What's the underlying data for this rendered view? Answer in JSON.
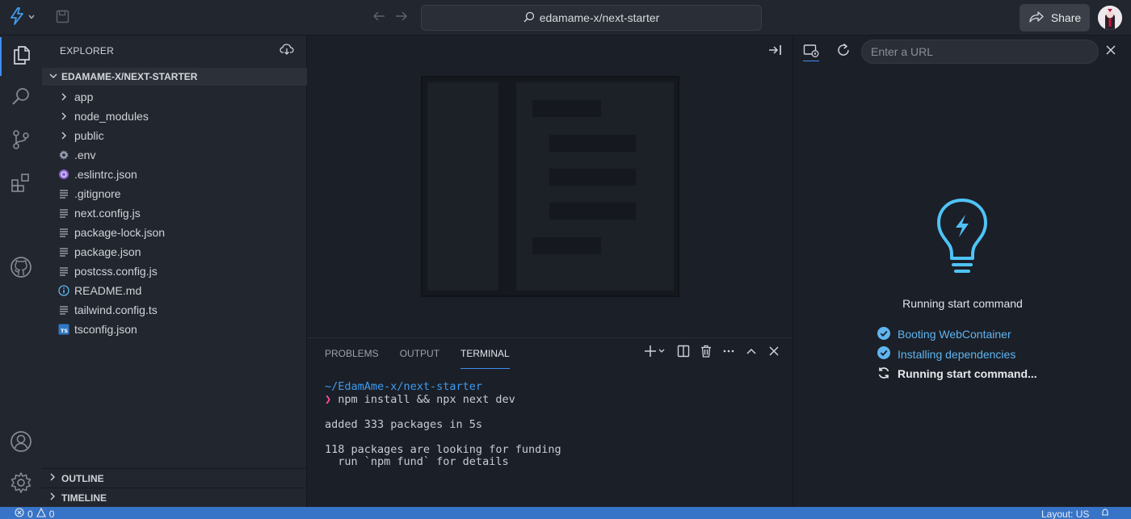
{
  "topbar": {
    "address": "edamame-x/next-starter",
    "share_label": "Share"
  },
  "activity": {
    "items": [
      "explorer",
      "search",
      "source-control",
      "extensions",
      "github",
      "accounts",
      "settings"
    ]
  },
  "sidebar": {
    "header": "EXPLORER",
    "folder": "EDAMAME-X/NEXT-STARTER",
    "items": [
      {
        "label": "app",
        "kind": "folder"
      },
      {
        "label": "node_modules",
        "kind": "folder"
      },
      {
        "label": "public",
        "kind": "folder"
      },
      {
        "label": ".env",
        "kind": "gear"
      },
      {
        "label": ".eslintrc.json",
        "kind": "eslint"
      },
      {
        "label": ".gitignore",
        "kind": "lines"
      },
      {
        "label": "next.config.js",
        "kind": "lines"
      },
      {
        "label": "package-lock.json",
        "kind": "lines"
      },
      {
        "label": "package.json",
        "kind": "lines"
      },
      {
        "label": "postcss.config.js",
        "kind": "lines"
      },
      {
        "label": "README.md",
        "kind": "info"
      },
      {
        "label": "tailwind.config.ts",
        "kind": "lines"
      },
      {
        "label": "tsconfig.json",
        "kind": "ts"
      }
    ],
    "outline": "OUTLINE",
    "timeline": "TIMELINE"
  },
  "panel": {
    "tabs": [
      "PROBLEMS",
      "OUTPUT",
      "TERMINAL"
    ],
    "active_tab": "TERMINAL",
    "terminal": {
      "path": "~/EdamAme-x/next-starter",
      "prompt": "❯",
      "command": " npm install && npx next dev",
      "out1": "added 333 packages in 5s",
      "out2": "118 packages are looking for funding",
      "out3": "  run `npm fund` for details"
    }
  },
  "preview": {
    "url_placeholder": "Enter a URL",
    "title": "Running start command",
    "steps": [
      {
        "label": "Booting WebContainer",
        "state": "done"
      },
      {
        "label": "Installing dependencies",
        "state": "done"
      },
      {
        "label": "Running start command...",
        "state": "running"
      }
    ]
  },
  "statusbar": {
    "errors": "0",
    "warnings": "0",
    "layout": "Layout: US"
  },
  "colors": {
    "accent": "#3f8ef5",
    "status_bar": "#3773c6",
    "bulb": "#4fc3f7",
    "terminal_path": "#3f9bf0",
    "terminal_prompt": "#ff4fa7"
  }
}
